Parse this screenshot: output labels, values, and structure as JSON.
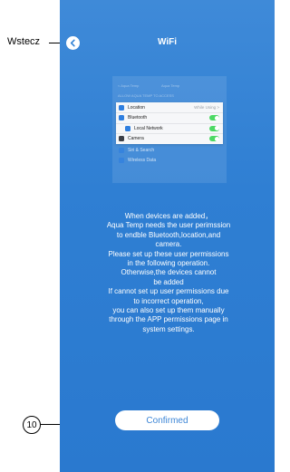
{
  "annotations": {
    "back_label": "Wstecz",
    "confirm_callout": "10"
  },
  "header": {
    "title": "WiFi",
    "back_icon": "chevron-left-icon"
  },
  "permissions_preview": {
    "ghost_header_left": "< Aqua Temp",
    "ghost_header_right": "Aqua Temp",
    "ghost_caption": "ALLOW AQUA TEMP TO ACCESS",
    "rows": [
      {
        "label": "Location",
        "value": "While Using >",
        "icon": "location-icon"
      },
      {
        "label": "Bluetooth",
        "toggle": true,
        "icon": "bluetooth-icon"
      },
      {
        "label": "Local Network",
        "toggle": true,
        "icon": "network-icon"
      },
      {
        "label": "Camera",
        "toggle": true,
        "icon": "camera-icon"
      }
    ],
    "extra_rows": [
      {
        "label": "Siri & Search",
        "icon": "siri-icon"
      },
      {
        "label": "Wireless Data",
        "icon": "wireless-icon"
      }
    ],
    "toggle_color": "#4cd964"
  },
  "message": {
    "lines": [
      "When devices are added，",
      "Aqua Temp needs the user perimssion",
      "to endble Bluetooth,location,and",
      "camera.",
      "Please set up these user permissions",
      "in the following operation.",
      "Otherwise,the devices cannot",
      "be added",
      "If cannot set up user permissions due",
      "to incorrect operation,",
      "you can also set up them manually",
      "through the APP permissions page in",
      "system settings."
    ]
  },
  "confirm_button": {
    "label": "Confirmed"
  },
  "colors": {
    "background": "#2f7fd3",
    "button_text": "#3d86d6"
  }
}
